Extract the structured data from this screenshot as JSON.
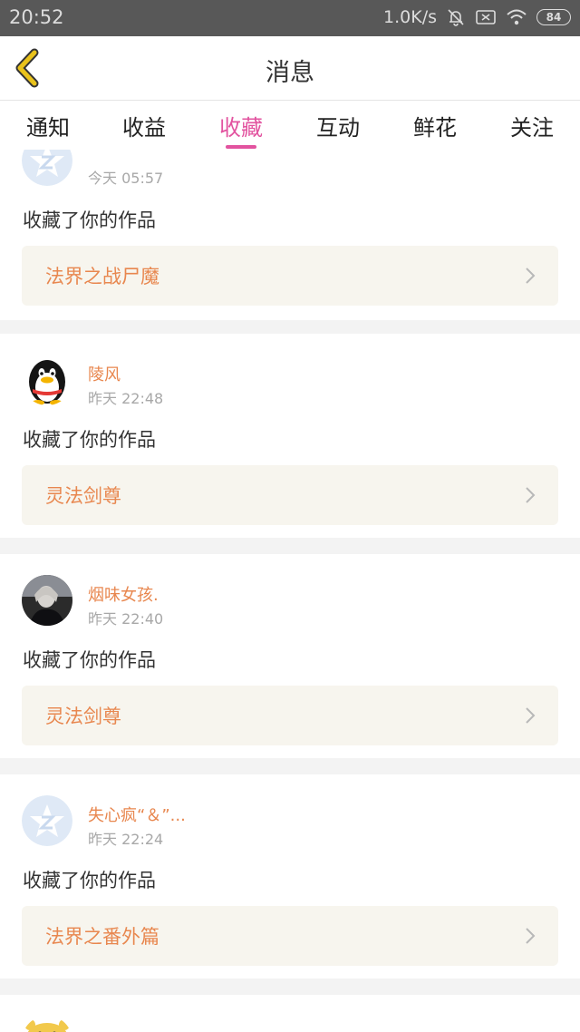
{
  "status_bar": {
    "time": "20:52",
    "speed": "1.0K/s",
    "battery": "84",
    "icons": [
      "mute-bell-icon",
      "sim-x-icon",
      "wifi-icon",
      "battery-icon"
    ]
  },
  "header": {
    "title": "消息",
    "back_icon": "back-chevron-icon",
    "accent_color": "#e2539f",
    "back_color": "#e9c21b"
  },
  "tabs": [
    {
      "label": "通知",
      "active": false
    },
    {
      "label": "收益",
      "active": false
    },
    {
      "label": "收藏",
      "active": true
    },
    {
      "label": "互动",
      "active": false
    },
    {
      "label": "鲜花",
      "active": false
    },
    {
      "label": "关注",
      "active": false
    }
  ],
  "messages": [
    {
      "user": "",
      "time": "今天 05:57",
      "action": "收藏了你的作品",
      "work": "法界之战尸魔",
      "avatar": "default-star-avatar"
    },
    {
      "user": "陵风",
      "time": "昨天 22:48",
      "action": "收藏了你的作品",
      "work": "灵法剑尊",
      "avatar": "penguin-avatar"
    },
    {
      "user": "烟味女孩.",
      "time": "昨天 22:40",
      "action": "收藏了你的作品",
      "work": "灵法剑尊",
      "avatar": "photo-avatar"
    },
    {
      "user": "失心疯“＆”...",
      "time": "昨天 22:24",
      "action": "收藏了你的作品",
      "work": "法界之番外篇",
      "avatar": "default-star-avatar"
    },
    {
      "user": "",
      "time": "",
      "action": "",
      "work": "",
      "avatar": "cartoon-avatar"
    }
  ],
  "colors": {
    "username": "#e8874f",
    "work_title": "#e8874f",
    "work_box_bg": "#f7f5ee",
    "timestamp": "#a8a8a8"
  }
}
